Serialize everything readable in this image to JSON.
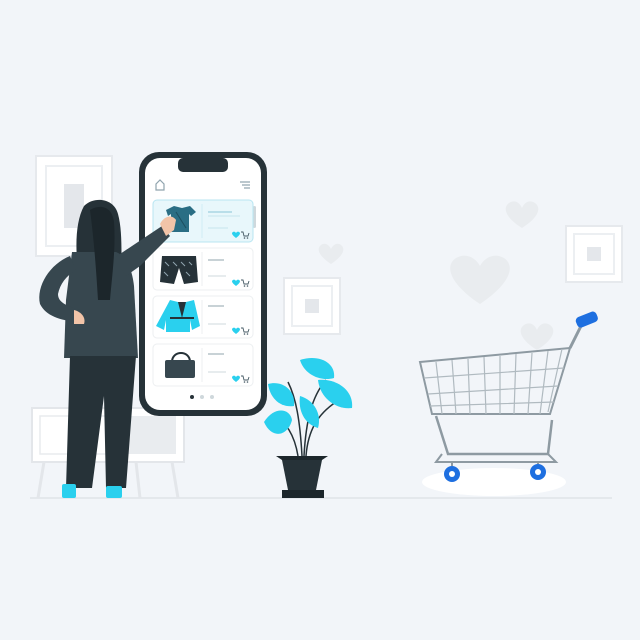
{
  "colors": {
    "background": "#f2f5f9",
    "accent": "#2ad0ee",
    "dark": "#263238",
    "suit": "#37474f",
    "frame": "#ffffff",
    "cart_wheel": "#1e6fe0",
    "heart": "#e9ecef"
  },
  "icons": {
    "home": "home-icon",
    "menu": "hamburger-menu-icon",
    "heart": "heart-icon",
    "cart": "cart-icon"
  },
  "phone": {
    "product_cards": [
      {
        "product": "t-shirt",
        "selected": true
      },
      {
        "product": "shorts",
        "selected": false
      },
      {
        "product": "jacket",
        "selected": false
      },
      {
        "product": "handbag",
        "selected": false
      }
    ],
    "pagination": {
      "pages": 3,
      "active": 1
    }
  }
}
